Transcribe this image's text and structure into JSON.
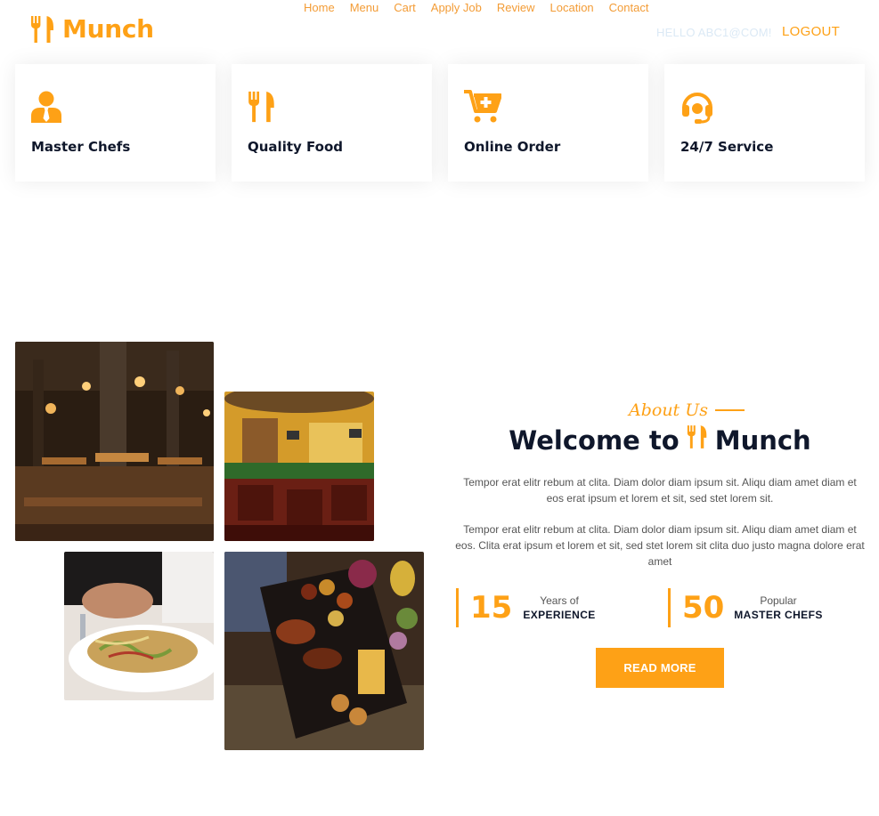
{
  "brand": {
    "name": "Munch",
    "icon": "utensils-icon",
    "color": "#FEA116"
  },
  "nav": {
    "links": [
      "Home",
      "Menu",
      "Cart",
      "Apply Job",
      "Review",
      "Location",
      "Contact"
    ],
    "greeting": "HELLO ABC1@COM!",
    "logout": "LOGOUT"
  },
  "services": [
    {
      "icon": "user-tie-icon",
      "title": "Master Chefs"
    },
    {
      "icon": "utensils-icon",
      "title": "Quality Food"
    },
    {
      "icon": "cart-plus-icon",
      "title": "Online Order"
    },
    {
      "icon": "headset-icon",
      "title": "24/7 Service"
    }
  ],
  "gallery": [
    "restaurant-interior-photo",
    "dining-room-photo",
    "pasta-plate-photo",
    "food-platter-photo"
  ],
  "about": {
    "subtitle": "About Us",
    "heading_prefix": "Welcome to",
    "heading_brand": "Munch",
    "paragraph_1": "Tempor erat elitr rebum at clita. Diam dolor diam ipsum sit. Aliqu diam amet diam et eos erat ipsum et lorem et sit, sed stet lorem sit.",
    "paragraph_2": "Tempor erat elitr rebum at clita. Diam dolor diam ipsum sit. Aliqu diam amet diam et eos. Clita erat ipsum et lorem et sit, sed stet lorem sit clita duo justo magna dolore erat amet",
    "stats": [
      {
        "number": "15",
        "label_top": "Years of",
        "label_bottom": "EXPERIENCE"
      },
      {
        "number": "50",
        "label_top": "Popular",
        "label_bottom": "MASTER CHEFS"
      }
    ],
    "button": "READ MORE"
  },
  "colors": {
    "primary": "#FEA116",
    "dark": "#0F172B",
    "text": "#555555"
  }
}
